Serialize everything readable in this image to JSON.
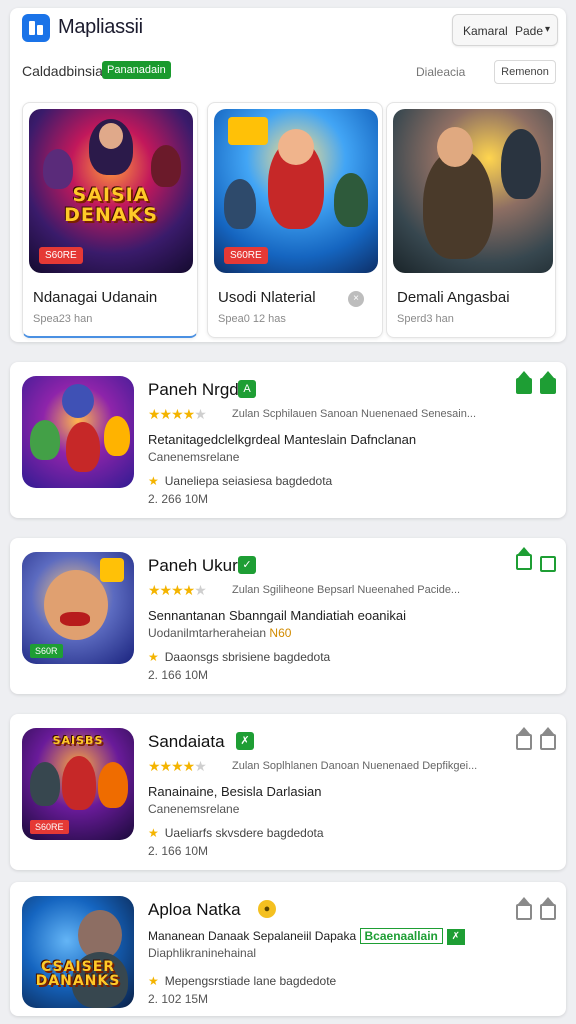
{
  "app": {
    "title": "Mapliassii",
    "logo_icon": "app-logo-icon"
  },
  "header_menu": {
    "item1": "Kamaral",
    "item2": "Pade",
    "chevron": "▾"
  },
  "categories": {
    "label": "Caldadbinsia",
    "badge": "Pananadain",
    "link": "Dialeacia",
    "button": "Remenon"
  },
  "featured": [
    {
      "name": "Ndanagai Udanain",
      "sub": "Spea23 han",
      "price": "S60RE",
      "art_text": "SAISIA DENAKS",
      "active": true
    },
    {
      "name": "Usodi Nlaterial",
      "sub": "Spea0 12 has",
      "price": "S60RE",
      "art_text": "",
      "active": false
    },
    {
      "name": "Demali Angasbai",
      "sub": "Sperd3 han",
      "price": "",
      "art_text": "",
      "active": false
    }
  ],
  "list": [
    {
      "title": "Paneh Nrgd",
      "tag": "A",
      "stars": 4,
      "rating_text": "Zulan Scphilauen Sanoan Nuenenaed Senesain...",
      "desc": "Retanitagedclelkgrdeal Manteslain Dafnclanan",
      "dev": "Canenemsrelane",
      "dev_highlight": "",
      "meta": "Uaneliepa seiasiesa bagdedota",
      "size": "2. 266 10M",
      "actions": [
        "green-fill",
        "green-fill"
      ]
    },
    {
      "title": "Paneh Ukur",
      "tag": "✓",
      "stars": 4,
      "rating_text": "Zulan Sgiliheone Bepsarl Nueenahed Pacide...",
      "desc": "Sennantanan Sbanngail Mandiatiah eoanikai",
      "dev": "Uodanilmtarheraheian",
      "dev_highlight": "N60",
      "meta": "Daaonsgs sbrisiene bagdedota",
      "size": "2. 166 10M",
      "actions": [
        "green-out",
        "green-out"
      ]
    },
    {
      "title": "Sandaiata",
      "tag": "✗",
      "stars": 4,
      "rating_text": "Zulan Soplhlanen Danoan Nuenenaed Depfikgei...",
      "desc": "Ranainaine, Besisla Darlasian",
      "dev": "Canenemsrelane",
      "dev_highlight": "",
      "meta": "Uaeliarfs skvsdere bagdedota",
      "size": "2. 166 10M",
      "actions": [
        "gray-out",
        "gray-out"
      ]
    },
    {
      "title": "Aploa Natka",
      "tag": "●",
      "stars": 0,
      "rating_text": "",
      "desc": "Mananean Danaak Sepalaneiil Dapaka",
      "desc_badge": "Bcaenaallain",
      "dev": "Diaphlikraninehainal",
      "dev_highlight": "",
      "meta": "Mepengsrstiade lane bagdedote",
      "size": "2. 102 15M",
      "actions": [
        "gray-out",
        "gray-out"
      ]
    }
  ]
}
